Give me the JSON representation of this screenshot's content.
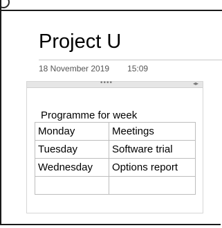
{
  "window": {
    "top_text": "...........Project U"
  },
  "page": {
    "title": "Project U",
    "date": "18 November 2019",
    "time": "15:09"
  },
  "note": {
    "drag_dots": "••••",
    "resize_arrows": "◂▸",
    "heading": "Programme for week",
    "rows": [
      [
        "Monday",
        "Meetings"
      ],
      [
        "Tuesday",
        "Software trial"
      ],
      [
        "Wednesday",
        "Options report"
      ],
      [
        "",
        ""
      ]
    ]
  }
}
